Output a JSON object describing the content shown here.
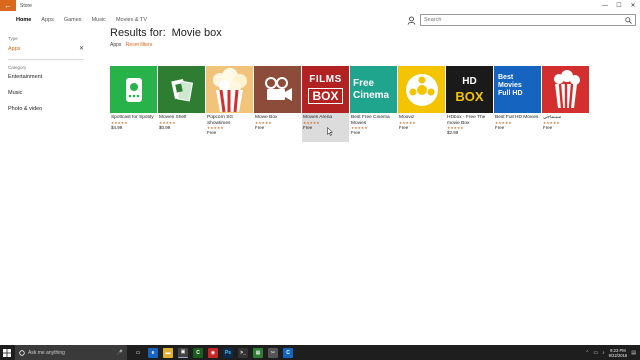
{
  "titlebar": {
    "title": "Store",
    "back_glyph": "←",
    "minimize": "—",
    "maximize": "☐",
    "close": "✕"
  },
  "nav": {
    "tabs": [
      "Home",
      "Apps",
      "Games",
      "Music",
      "Movies & TV"
    ],
    "active_index": 0
  },
  "search": {
    "placeholder": "Search"
  },
  "filters": {
    "type_label": "Type",
    "type_value": "Apps",
    "clear_glyph": "✕",
    "category_label": "Category",
    "categories": [
      "Entertainment",
      "Music",
      "Photo & video"
    ]
  },
  "results": {
    "prefix": "Results for:",
    "query": "Movie box",
    "filter_chip": "Apps",
    "reset_label": "Reset filters"
  },
  "apps": [
    {
      "name": "Spotlcast for Spotify",
      "stars": "★★★★★",
      "price": "$4.99",
      "color": "#27b24a",
      "icon": "music-device-icon"
    },
    {
      "name": "Movies Shelf",
      "stars": "★★★★★",
      "price": "$0.99",
      "color": "#2e7d32",
      "icon": "film-shelf-icon"
    },
    {
      "name": "Popcorn SG Showtimes",
      "stars": "★★★★★",
      "price": "Free",
      "color": "#f2c37a",
      "icon": "popcorn-icon"
    },
    {
      "name": "Movie Box",
      "stars": "★★★★★",
      "price": "Free",
      "color": "#8d4b3a",
      "icon": "projector-icon"
    },
    {
      "name": "Movies Arena",
      "stars": "★★★★★",
      "price": "Free",
      "color": "#b22222",
      "icon": "films-box-logo",
      "art_line1": "FILMS",
      "art_line2": "BOX"
    },
    {
      "name": "Best Free Cinema Movies",
      "stars": "★★★★★",
      "price": "Free",
      "color": "#1fa58e",
      "icon": "free-cinema-logo",
      "art_line1": "Free",
      "art_line2": "Cinema"
    },
    {
      "name": "Mooviz",
      "stars": "★★★★★",
      "price": "Free",
      "color": "#f5c400",
      "icon": "film-reel-icon"
    },
    {
      "name": "HDbox - Free The movie Box",
      "stars": "★★★★★",
      "price": "$2.99",
      "color": "#1a1a1a",
      "icon": "hdbox-logo",
      "art_line1": "HD",
      "art_line2": "BOX"
    },
    {
      "name": "Best Full HD Movies",
      "stars": "★★★★★",
      "price": "Free",
      "color": "#1565c0",
      "icon": "full-hd-logo",
      "art_line1": "Best Movies Full HD"
    },
    {
      "name": "سينماجي",
      "stars": "★★★★★",
      "price": "Free",
      "color": "#d32f2f",
      "icon": "popcorn-cup-icon"
    }
  ],
  "taskbar": {
    "search_placeholder": "Ask me anything",
    "mic_glyph": "🎤",
    "apps": [
      {
        "icon": "task-view-icon",
        "color": "#1e1e1e",
        "glyph": "▭"
      },
      {
        "icon": "edge-icon",
        "color": "#1565c0",
        "glyph": "e"
      },
      {
        "icon": "file-explorer-icon",
        "color": "#e0b030",
        "glyph": "▬"
      },
      {
        "icon": "store-icon",
        "color": "#444444",
        "glyph": "▣"
      },
      {
        "icon": "camtasia-icon",
        "color": "#1b5e20",
        "glyph": "C"
      },
      {
        "icon": "chrome-icon",
        "color": "#c62828",
        "glyph": "◉"
      },
      {
        "icon": "photoshop-icon",
        "color": "#0d2a4a",
        "glyph": "Ps"
      },
      {
        "icon": "cmd-icon",
        "color": "#333333",
        "glyph": ">_"
      },
      {
        "icon": "green-app-icon",
        "color": "#2e7d32",
        "glyph": "▦"
      },
      {
        "icon": "snipping-icon",
        "color": "#555555",
        "glyph": "✂"
      },
      {
        "icon": "camtasia-recorder-icon",
        "color": "#1565c0",
        "glyph": "C"
      }
    ],
    "time": "9:23 PM",
    "date": "9/22/2016",
    "tray_glyphs": [
      "⌃",
      "▭",
      "♪",
      "▤"
    ]
  }
}
